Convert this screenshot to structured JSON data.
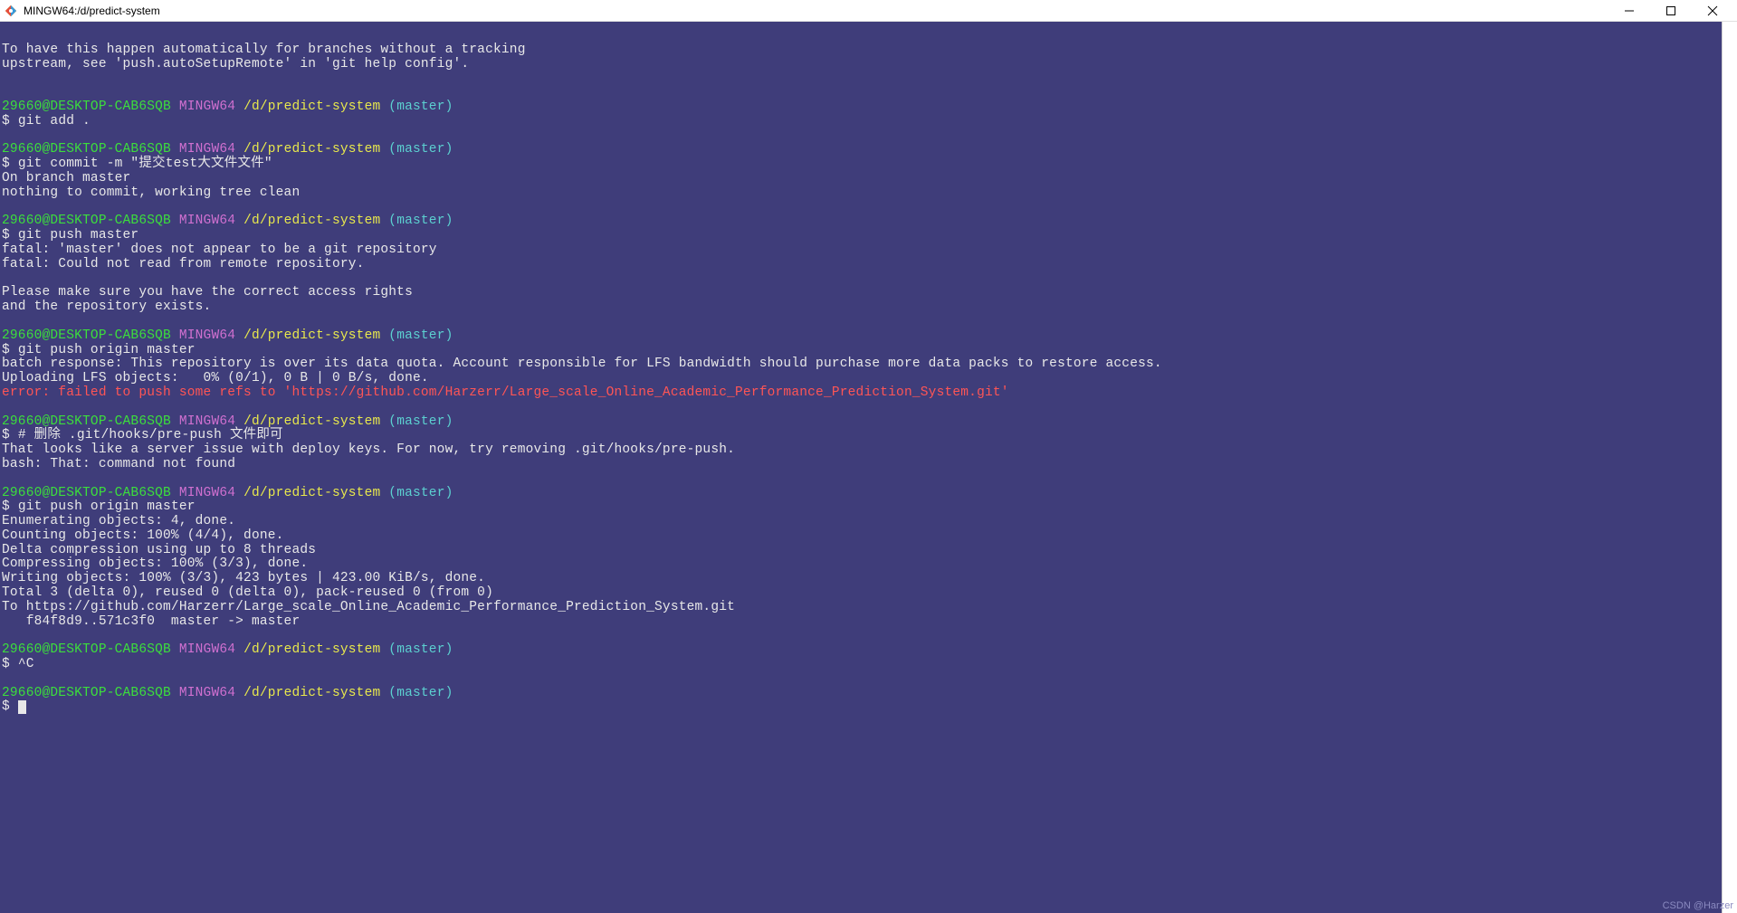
{
  "window": {
    "title": "MINGW64:/d/predict-system"
  },
  "prompt": {
    "user": "29660@DESKTOP-CAB6SQB",
    "host": "MINGW64",
    "path": "/d/predict-system",
    "branch": "(master)",
    "symbol": "$"
  },
  "lines": {
    "l1": "To have this happen automatically for branches without a tracking",
    "l2": "upstream, see 'push.autoSetupRemote' in 'git help config'.",
    "cmd1": "git add .",
    "cmd2": "git commit -m \"提交test大文件文件\"",
    "out2a": "On branch master",
    "out2b": "nothing to commit, working tree clean",
    "cmd3": "git push master",
    "out3a": "fatal: 'master' does not appear to be a git repository",
    "out3b": "fatal: Could not read from remote repository.",
    "out3c": "Please make sure you have the correct access rights",
    "out3d": "and the repository exists.",
    "cmd4": "git push origin master",
    "out4a": "batch response: This repository is over its data quota. Account responsible for LFS bandwidth should purchase more data packs to restore access.",
    "out4b": "Uploading LFS objects:   0% (0/1), 0 B | 0 B/s, done.",
    "out4c": "error: failed to push some refs to 'https://github.com/Harzerr/Large_scale_Online_Academic_Performance_Prediction_System.git'",
    "cmd5": "# 删除 .git/hooks/pre-push 文件即可",
    "out5a": "That looks like a server issue with deploy keys. For now, try removing .git/hooks/pre-push.",
    "out5b": "bash: That: command not found",
    "cmd6": "git push origin master",
    "out6a": "Enumerating objects: 4, done.",
    "out6b": "Counting objects: 100% (4/4), done.",
    "out6c": "Delta compression using up to 8 threads",
    "out6d": "Compressing objects: 100% (3/3), done.",
    "out6e": "Writing objects: 100% (3/3), 423 bytes | 423.00 KiB/s, done.",
    "out6f": "Total 3 (delta 0), reused 0 (delta 0), pack-reused 0 (from 0)",
    "out6g": "To https://github.com/Harzerr/Large_scale_Online_Academic_Performance_Prediction_System.git",
    "out6h": "   f84f8d9..571c3f0  master -> master",
    "cmd7": "^C"
  },
  "watermark": "CSDN @Harzer"
}
